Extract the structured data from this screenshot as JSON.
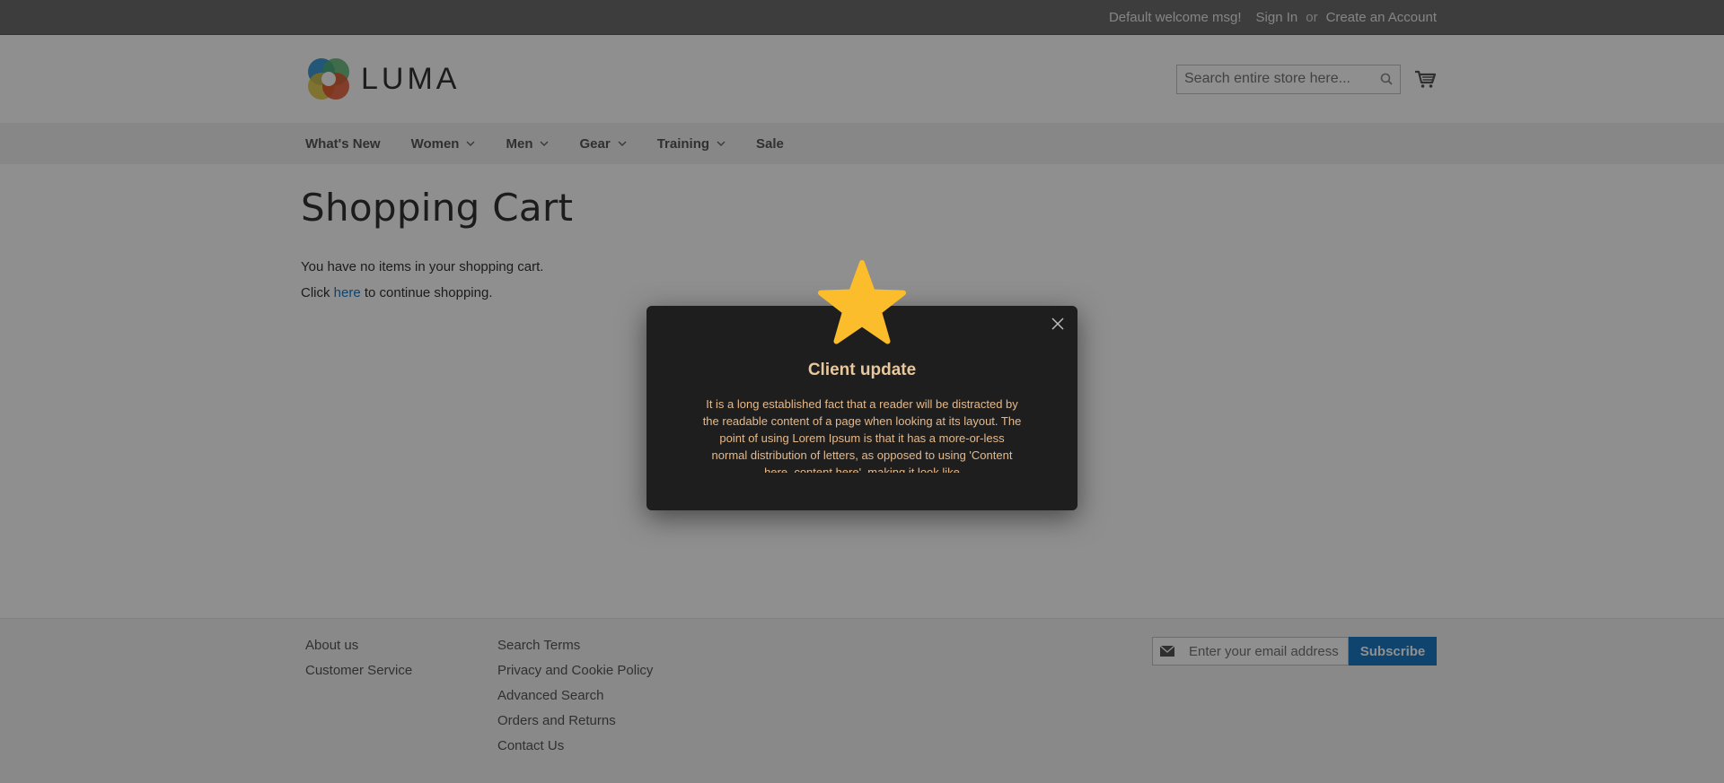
{
  "topbar": {
    "welcome": "Default welcome msg!",
    "sign_in": "Sign In",
    "or": "or",
    "create_account": "Create an Account"
  },
  "header": {
    "logo_text": "LUMA",
    "search_placeholder": "Search entire store here..."
  },
  "nav": {
    "items": [
      {
        "label": "What's New",
        "has_dropdown": false
      },
      {
        "label": "Women",
        "has_dropdown": true
      },
      {
        "label": "Men",
        "has_dropdown": true
      },
      {
        "label": "Gear",
        "has_dropdown": true
      },
      {
        "label": "Training",
        "has_dropdown": true
      },
      {
        "label": "Sale",
        "has_dropdown": false
      }
    ]
  },
  "main": {
    "title": "Shopping Cart",
    "empty_message": "You have no items in your shopping cart.",
    "continue_prefix": "Click",
    "continue_link": "here",
    "continue_suffix": "to continue shopping."
  },
  "footer": {
    "col1": [
      "About us",
      "Customer Service"
    ],
    "col2": [
      "Search Terms",
      "Privacy and Cookie Policy",
      "Advanced Search",
      "Orders and Returns",
      "Contact Us"
    ],
    "newsletter_placeholder": "Enter your email address",
    "subscribe_label": "Subscribe"
  },
  "modal": {
    "title": "Client update",
    "body": "It is a long established fact that a reader will be distracted by the readable content of a page when looking at its layout. The point of using Lorem Ipsum is that it has a more-or-less normal distribution of letters, as opposed to using 'Content here, content here', making it look like"
  },
  "colors": {
    "link": "#1979c3",
    "star": "#fbbd2b",
    "modal_bg": "#1e1e1e",
    "modal_title": "#e8c79c",
    "modal_text": "#e6b98a"
  }
}
